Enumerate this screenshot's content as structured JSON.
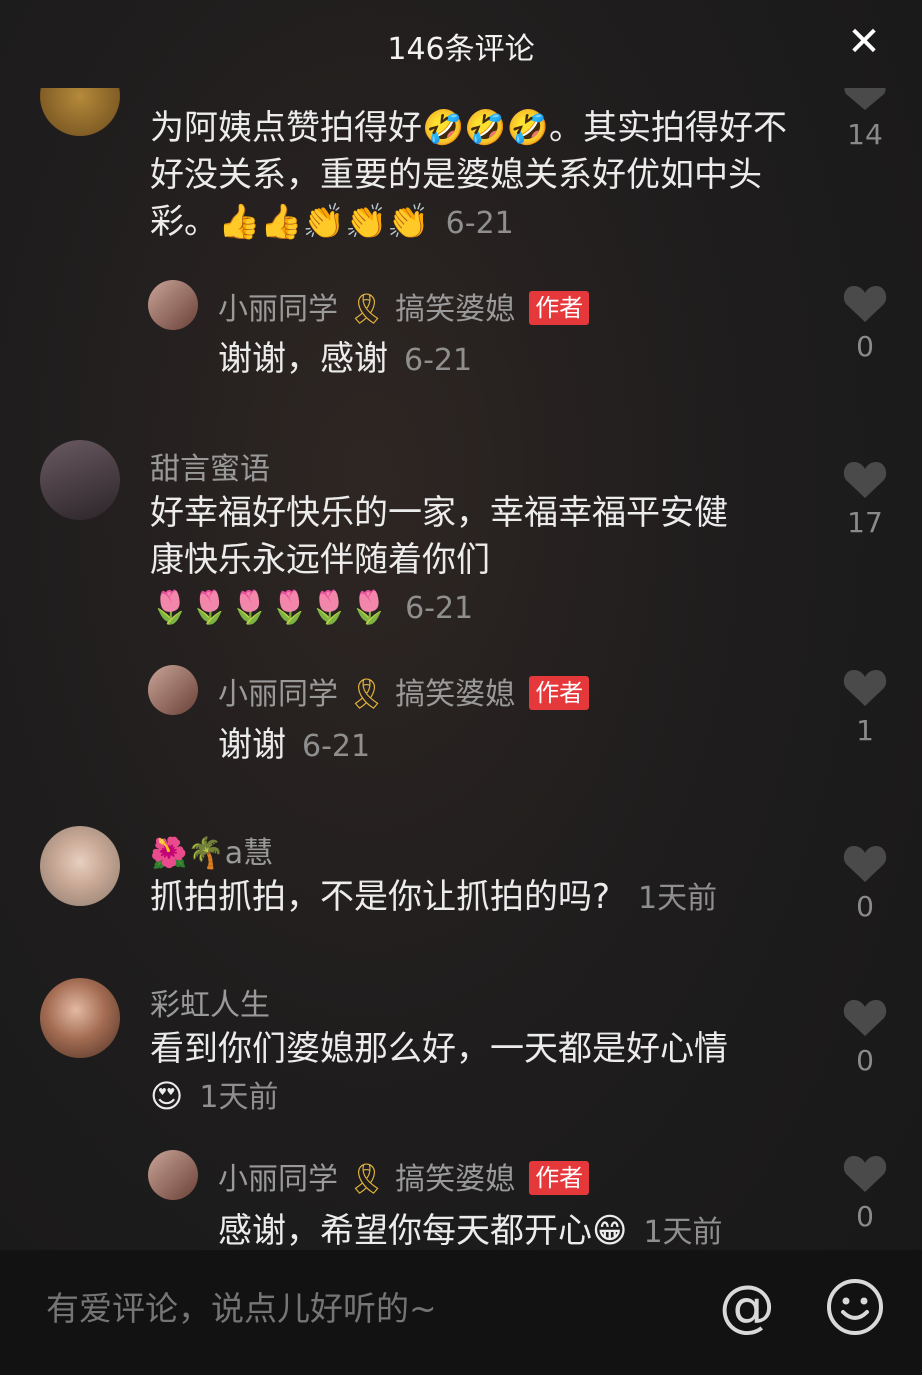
{
  "header": {
    "title": "146条评论",
    "close_icon": "close-icon"
  },
  "comments": [
    {
      "text": "为阿姨点赞拍得好🤣🤣🤣。其实拍得好不好没关系，重要的是婆媳关系好优如中头彩。👍👍👏👏👏",
      "date": "6-21",
      "likes": "14",
      "reply": {
        "name": "小丽同学",
        "ribbon": "🎗",
        "tag": "搞笑婆媳",
        "badge": "作者",
        "text": "谢谢，感谢",
        "date": "6-21",
        "likes": "0"
      }
    },
    {
      "name": "甜言蜜语",
      "text_line1": "好幸福好快乐的一家，幸福幸福平安健",
      "text_line2": "康快乐永远伴随着你们",
      "emojis": "🌷🌷🌷🌷🌷🌷",
      "date": "6-21",
      "likes": "17",
      "reply": {
        "name": "小丽同学",
        "ribbon": "🎗",
        "tag": "搞笑婆媳",
        "badge": "作者",
        "text": "谢谢",
        "date": "6-21",
        "likes": "1"
      }
    },
    {
      "name": "🌺🌴a慧",
      "text": "抓拍抓拍，不是你让抓拍的吗?",
      "date": "1天前",
      "likes": "0"
    },
    {
      "name": "彩虹人生",
      "text": "看到你们婆媳那么好，一天都是好心情",
      "emoji": "😍",
      "date": "1天前",
      "likes": "0",
      "reply": {
        "name": "小丽同学",
        "ribbon": "🎗",
        "tag": "搞笑婆媳",
        "badge": "作者",
        "text": "感谢，希望你每天都开心😁",
        "date": "1天前",
        "likes": "0"
      }
    }
  ],
  "footer": {
    "placeholder": "有爱评论，说点儿好听的~",
    "at_label": "@",
    "emoji_icon": "smile-icon"
  },
  "colors": {
    "badge": "#e5383b",
    "ribbon": "#e0b23a",
    "background": "#1f1d1d"
  }
}
